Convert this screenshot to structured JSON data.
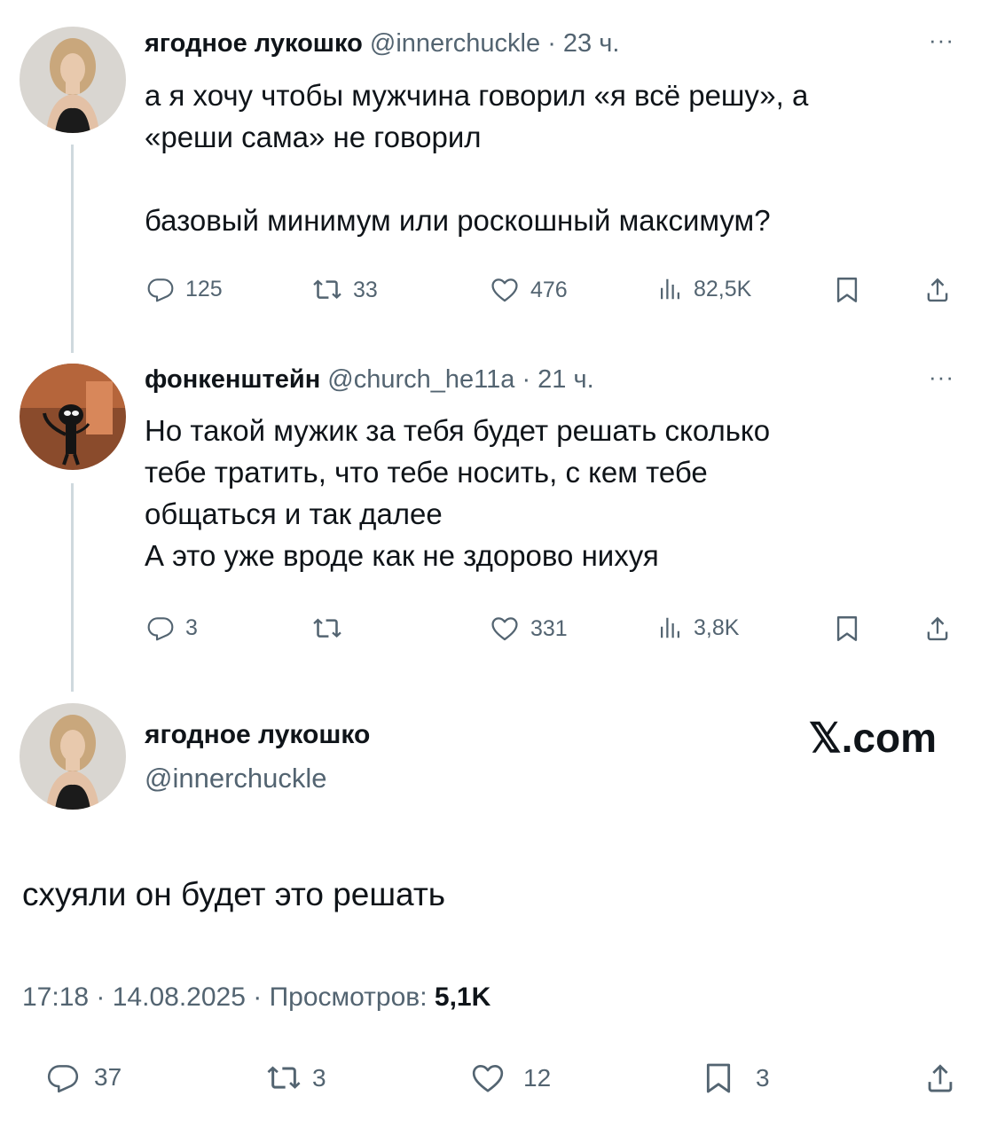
{
  "tweets": [
    {
      "name": "ягодное лукошко",
      "handle": "@innerchuckle",
      "time": "· 23 ч.",
      "text": "а я хочу чтобы мужчина говорил «я всё решу», а\n«реши сама» не говорил\n\nбазовый минимум или роскошный максимум?",
      "replies": "125",
      "retweets": "33",
      "likes": "476",
      "views": "82,5K"
    },
    {
      "name": "фонкенштейн",
      "handle": "@church_he11a",
      "time": "· 21 ч.",
      "text": "Но такой мужик за тебя будет решать сколько\nтебе тратить, что тебе носить, с кем тебе\nобщаться и так далее\nА это уже вроде как не здорово нихуя",
      "replies": "3",
      "retweets": "",
      "likes": "331",
      "views": "3,8K"
    }
  ],
  "main": {
    "name": "ягодное лукошко",
    "handle": "@innerchuckle",
    "text": "схуяли он будет это решать",
    "time": "17:18",
    "date": "14.08.2025",
    "views_label": "Просмотров:",
    "views": "5,1K",
    "replies": "37",
    "retweets": "3",
    "likes": "12",
    "bookmarks": "3"
  },
  "brand": "𝕏.com",
  "icons": [
    "reply-icon",
    "retweet-icon",
    "like-icon",
    "views-icon",
    "bookmark-icon",
    "share-icon",
    "more-icon"
  ],
  "colors": {
    "text": "#0f1419",
    "muted": "#536471",
    "line": "#cfd9de"
  }
}
